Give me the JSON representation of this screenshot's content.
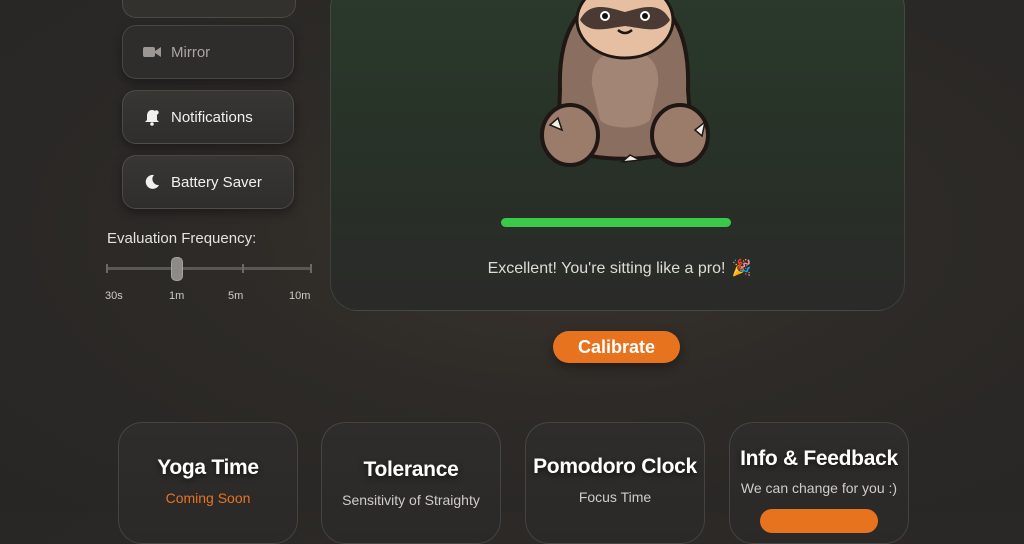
{
  "sidebar": {
    "buttons": [
      {
        "label": "Mirror",
        "icon": "video-camera-icon"
      },
      {
        "label": "Notifications",
        "icon": "bell-icon"
      },
      {
        "label": "Battery Saver",
        "icon": "moon-icon"
      }
    ],
    "frequency": {
      "label": "Evaluation Frequency:",
      "ticks": [
        "30s",
        "1m",
        "5m",
        "10m"
      ],
      "selected": "1m"
    }
  },
  "posture": {
    "status_text": "Excellent! You're sitting like a pro!",
    "status_emoji": "🎉",
    "score_fraction": 1.0,
    "progress_color": "#3cc84a"
  },
  "calibrate_label": "Calibrate",
  "accent_color": "#e8731f",
  "cards": [
    {
      "title": "Yoga Time",
      "subtitle": "Coming Soon"
    },
    {
      "title": "Tolerance",
      "subtitle": "Sensitivity of Straighty"
    },
    {
      "title": "Pomodoro Clock",
      "subtitle": "Focus Time"
    },
    {
      "title": "Info & Feedback",
      "subtitle": "We can change for you :)"
    }
  ]
}
